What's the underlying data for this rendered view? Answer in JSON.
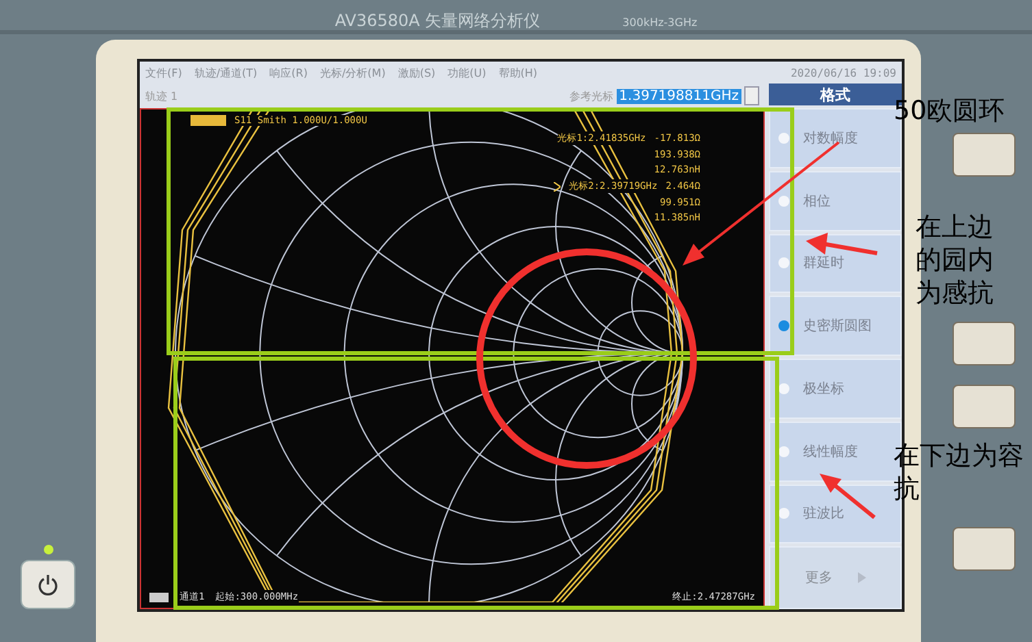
{
  "device": {
    "model": "AV36580A 矢量网络分析仪",
    "range": "300kHz-3GHz"
  },
  "menu": [
    {
      "label": "文件(F)"
    },
    {
      "label": "轨迹/通道(T)"
    },
    {
      "label": "响应(R)"
    },
    {
      "label": "光标/分析(M)"
    },
    {
      "label": "激励(S)"
    },
    {
      "label": "功能(U)"
    },
    {
      "label": "帮助(H)"
    }
  ],
  "datetime": "2020/06/16 19:09",
  "toolbar": {
    "trace": "轨迹 1",
    "ref_label": "参考光标",
    "ref_value": "1.397198811GHz"
  },
  "trace_header": "S11 Smith 1.000U/1.000U",
  "marker_readouts": [
    {
      "label": "光标1:2.41835GHz",
      "values": [
        "-17.813Ω",
        "193.938Ω",
        "12.763nH"
      ],
      "active": false
    },
    {
      "label": "光标2:2.39719GHz",
      "values": [
        "2.464Ω",
        "99.951Ω",
        "11.385nH"
      ],
      "active": true
    }
  ],
  "status": {
    "channel": "通道1",
    "start": "起始:300.000MHz",
    "stop": "终止:2.47287GHz"
  },
  "format_panel": {
    "title": "格式",
    "options": [
      {
        "label": "对数幅度",
        "selected": false
      },
      {
        "label": "相位",
        "selected": false
      },
      {
        "label": "群延时",
        "selected": false
      },
      {
        "label": "史密斯圆图",
        "selected": true
      },
      {
        "label": "极坐标",
        "selected": false
      },
      {
        "label": "线性幅度",
        "selected": false
      },
      {
        "label": "驻波比",
        "selected": false
      }
    ],
    "more": "更多"
  },
  "annotations": [
    {
      "text": "50欧圆环"
    },
    {
      "text": "在上边的园内为感抗"
    },
    {
      "text": "在下边为容抗"
    }
  ]
}
